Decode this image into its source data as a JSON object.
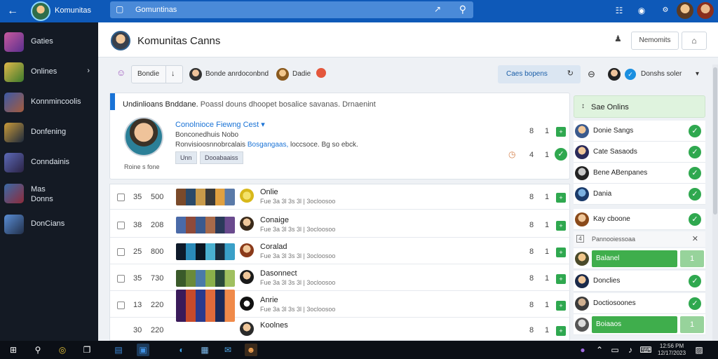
{
  "topbar": {
    "app_title": "Komunitas",
    "search_text": "Gomuntinas",
    "colors": {
      "bar": "#0e59b8",
      "search": "#4a8ad8"
    }
  },
  "sidebar": {
    "items": [
      {
        "label": "Gaties"
      },
      {
        "label": "Onlines"
      },
      {
        "label": "Konnmincoolis"
      },
      {
        "label": "Donfening"
      },
      {
        "label": "Conndainis"
      },
      {
        "label": "Mas",
        "label2": "Donns"
      },
      {
        "label": "DonCians"
      }
    ]
  },
  "header": {
    "title": "Komunitas Canns",
    "button_label": "Nemomits"
  },
  "filterbar": {
    "segment_label": "Bondie",
    "user_label": "Bonde anrdoconbnd",
    "user2_label": "Dadie",
    "sort_label": "Caes bopens",
    "online_label": "Donshs soler"
  },
  "featured": {
    "heading": "Undinlioans Bnddane.",
    "heading_sub": "Poassl douns dhoopet bosalice savanas. Drnaenint",
    "name_link": "Conolnioce Fiewng Cest",
    "meta": "Bonconedhuis Nobo",
    "desc_prefix": "Ronvisioosnnobrcalais",
    "desc_highlight": "Bosgangaas,",
    "desc_suffix": "loccsoce. Bg so ebck.",
    "caption": "Roine s fone",
    "tags": [
      "Unn",
      "Dooabaaiss"
    ],
    "counts": [
      {
        "a": "8",
        "b": "1"
      },
      {
        "a": "4",
        "b": "1"
      }
    ]
  },
  "rows": [
    {
      "n1": "35",
      "n2": "500",
      "title": "Onlie",
      "sub": "Fue 3a 3l 3s 3l | 3ocloosoo",
      "c1": "8",
      "c2": "1"
    },
    {
      "n1": "38",
      "n2": "208",
      "title": "Conaige",
      "sub": "Fue 3a 3l 3s 3l | 3ocloosoo",
      "c1": "8",
      "c2": "1"
    },
    {
      "n1": "25",
      "n2": "800",
      "title": "Coralad",
      "sub": "Fue 3a 3l 3s 3l | 3ocloosoo",
      "c1": "8",
      "c2": "1"
    },
    {
      "n1": "35",
      "n2": "730",
      "title": "Dasonnect",
      "sub": "Fue 3a 3l 3s 3l | 3ocloosoo",
      "c1": "8",
      "c2": "1"
    },
    {
      "n1": "13",
      "n2": "220",
      "title": "Anrie",
      "sub": "Fue 3a 3l 3s 3l | 3ocloosoo",
      "c1": "8",
      "c2": "1"
    },
    {
      "n1": "30",
      "n2": "220",
      "title": "Koolnes",
      "sub": "Fue 3a 3l 3s 3l | 3ocloosoo",
      "c1": "8",
      "c2": "1"
    }
  ],
  "online_panel": {
    "header": "Sae Onlins",
    "users": [
      "Donie Sangs",
      "Cate Sasaods",
      "Bene ABenpanes",
      "Dania",
      "Kay cboone"
    ],
    "sub_header": "Pannooiessoaa",
    "green1_label": "Balanel",
    "green1_count": "1",
    "users2": [
      "Donclies",
      "Doctiosoones"
    ],
    "green2_label": "Boiaaos",
    "green2_count": "1"
  },
  "taskbar": {
    "clock_time": "12:56 PM",
    "clock_date": "12/17/2023"
  }
}
